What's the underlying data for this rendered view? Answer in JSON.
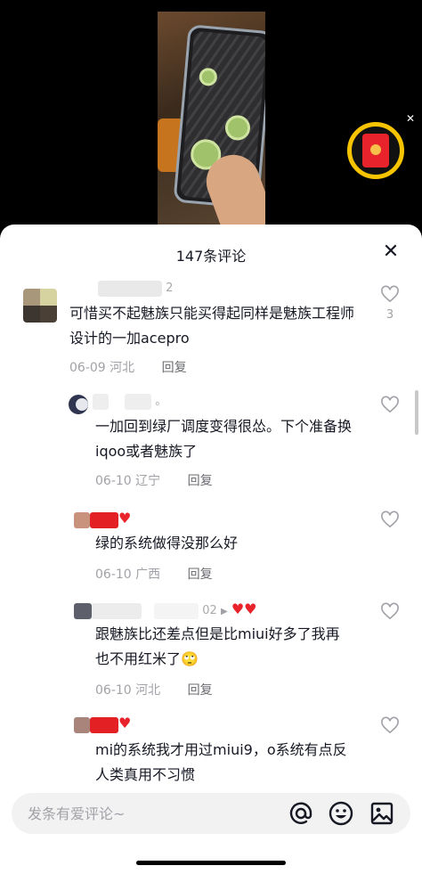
{
  "sheet": {
    "title": "147条评论"
  },
  "comments": [
    {
      "name_suffix": "2",
      "text": "可惜买不起魅族只能买得起同样是魅族工程师设计的一加acepro",
      "date": "06-09",
      "location": "河北",
      "reply_label": "回复",
      "likes": "3"
    },
    {
      "name_suffix": "。",
      "text": "一加回到绿厂调度变得很怂。下个准备换iqoo或者魅族了",
      "date": "06-10",
      "location": "辽宁",
      "reply_label": "回复"
    },
    {
      "text": "绿的系统做得没那么好",
      "date": "06-10",
      "location": "广西",
      "reply_label": "回复"
    },
    {
      "name_suffix": "02",
      "text": "跟魅族比还差点但是比miui好多了我再也不用红米了🙄",
      "date": "06-10",
      "location": "河北",
      "reply_label": "回复"
    },
    {
      "text": "mi的系统我才用过miui9，o系统有点反人类真用不习惯"
    }
  ],
  "input": {
    "placeholder": "发条有爱评论~"
  },
  "colors": {
    "accent": "#e8232b",
    "ring": "#f8c400",
    "text": "#161823",
    "meta": "#a1a2a7"
  },
  "icons": [
    "heart-outline-icon",
    "close-icon",
    "at-icon",
    "emoji-icon",
    "image-icon",
    "red-packet-icon",
    "play-arrow-icon"
  ]
}
